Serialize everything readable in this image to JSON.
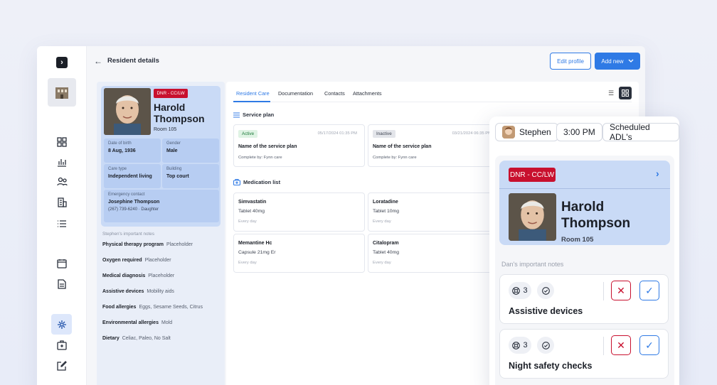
{
  "topbar": {
    "title": "Resident details",
    "edit_label": "Edit profile",
    "add_label": "Add new"
  },
  "resident": {
    "dnr": "DNR - CC/LW",
    "first_name": "Harold",
    "last_name": "Thompson",
    "room": "Room 105",
    "info": [
      {
        "label": "Date of birth",
        "value": "8 Aug, 1936"
      },
      {
        "label": "Gender",
        "value": "Male"
      },
      {
        "label": "Care type",
        "value": "Independent living"
      },
      {
        "label": "Building",
        "value": "Top court"
      }
    ],
    "emergency": {
      "label": "Emergency contact",
      "name": "Josephine Thompson",
      "detail": "(267) 739-6240  ·  Daughter"
    },
    "notes_title": "Stephen's important notes",
    "notes": [
      {
        "label": "Physical therapy program",
        "value": "Placeholder"
      },
      {
        "label": "Oxygen required",
        "value": "Placeholder"
      },
      {
        "label": "Medical diagnosis",
        "value": "Placeholder"
      },
      {
        "label": "Assistive devices",
        "value": "Mobility aids"
      },
      {
        "label": "Food allergies",
        "value": "Eggs, Sesame Seeds, Citrus"
      },
      {
        "label": "Environmental allergies",
        "value": "Mold"
      },
      {
        "label": "Dietary",
        "value": "Celiac, Paleo, No Salt"
      }
    ]
  },
  "tabs": [
    "Resident Care",
    "Documentation",
    "Contacts",
    "Attachments"
  ],
  "service_plan": {
    "title": "Service plan",
    "cards": [
      {
        "status": "Active",
        "date": "05/17/2024 01:35 PM",
        "name": "Name of the service plan",
        "sub": "Complete by: Fynn care"
      },
      {
        "status": "Inactive",
        "date": "03/21/2024 06:35 PM",
        "name": "Name of the service plan",
        "sub": "Complete by: Fynn care"
      }
    ]
  },
  "medication": {
    "title": "Medication list",
    "items": [
      {
        "name": "Simvastatin",
        "dose": "Tablet 40mg",
        "freq": "Every day"
      },
      {
        "name": "Loratadine",
        "dose": "Tablet 10mg",
        "freq": "Every day"
      },
      {
        "name": "Memantine Hc",
        "dose": "Capsule 21mg Er",
        "freq": "Every day"
      },
      {
        "name": "Citalopram",
        "dose": "Tablet 40mg",
        "freq": "Every day"
      }
    ]
  },
  "mobile": {
    "user": "Stephen",
    "time": "3:00 PM",
    "schedule": "Scheduled ADL's",
    "dnr": "DNR - CC/LW",
    "first_name": "Harold",
    "last_name": "Thompson",
    "room": "Room 105",
    "notes_title": "Dan's important notes",
    "notes": [
      {
        "count": "3",
        "title": "Assistive devices"
      },
      {
        "count": "3",
        "title": "Night safety checks"
      }
    ]
  },
  "colors": {
    "accent": "#2f7ae5",
    "danger": "#c8102e",
    "card_blue": "#c9daf6"
  }
}
